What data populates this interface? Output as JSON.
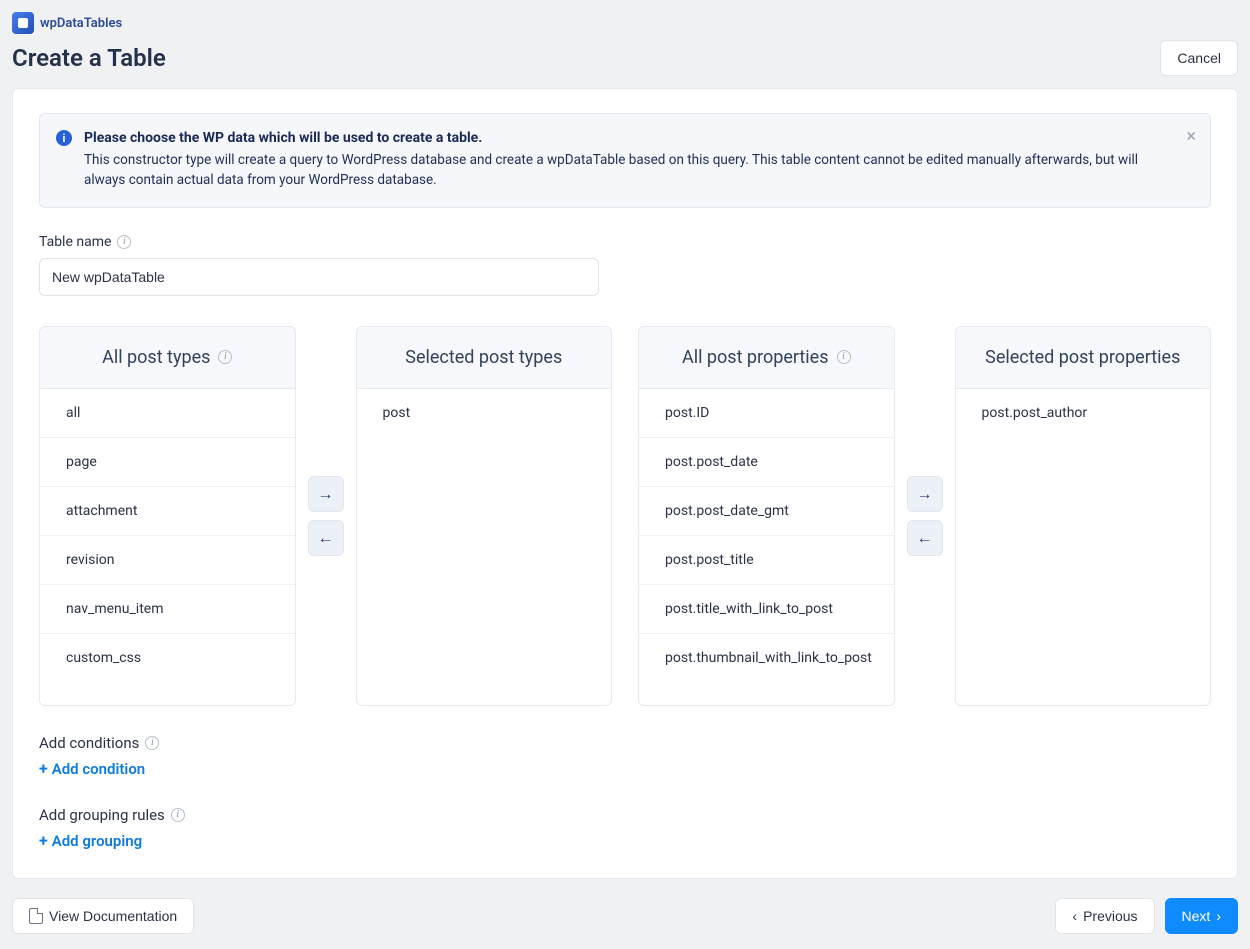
{
  "brand": {
    "name": "wpDataTables"
  },
  "header": {
    "title": "Create a Table",
    "cancel": "Cancel"
  },
  "alert": {
    "title": "Please choose the WP data which will be used to create a table.",
    "body": "This constructor type will create a query to WordPress database and create a wpDataTable based on this query. This table content cannot be edited manually afterwards, but will always contain actual data from your WordPress database."
  },
  "table_name": {
    "label": "Table name",
    "value": "New wpDataTable"
  },
  "columns": {
    "all_post_types": {
      "title": "All post types",
      "items": [
        "all",
        "page",
        "attachment",
        "revision",
        "nav_menu_item",
        "custom_css"
      ]
    },
    "selected_post_types": {
      "title": "Selected post types",
      "items": [
        "post"
      ]
    },
    "all_post_properties": {
      "title": "All post properties",
      "items": [
        "post.ID",
        "post.post_date",
        "post.post_date_gmt",
        "post.post_title",
        "post.title_with_link_to_post",
        "post.thumbnail_with_link_to_post"
      ]
    },
    "selected_post_properties": {
      "title": "Selected post properties",
      "items": [
        "post.post_author"
      ]
    }
  },
  "conditions": {
    "label": "Add conditions",
    "action": "Add condition"
  },
  "grouping": {
    "label": "Add grouping rules",
    "action": "Add grouping"
  },
  "footer": {
    "doc": "View Documentation",
    "prev": "Previous",
    "next": "Next"
  }
}
